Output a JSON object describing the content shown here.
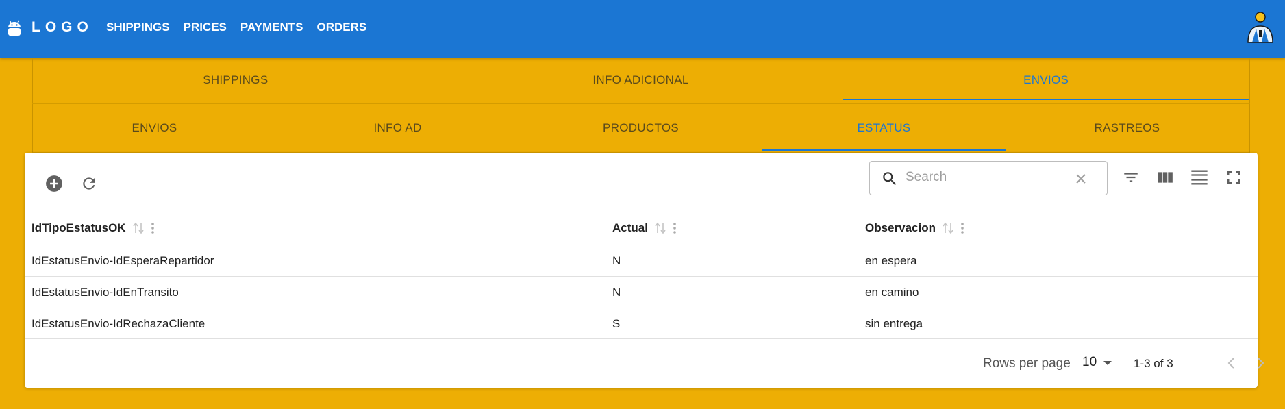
{
  "appbar": {
    "logo_text": "LOGO",
    "logo_icon": "android-icon",
    "nav": [
      "SHIPPINGS",
      "PRICES",
      "PAYMENTS",
      "ORDERS"
    ],
    "avatar_icon": "user-avatar-icon",
    "color": "#1B76D3"
  },
  "tabs_level1": [
    "SHIPPINGS",
    "INFO ADICIONAL",
    "ENVIOS"
  ],
  "tabs_level1_active": "ENVIOS",
  "tabs_level2": [
    "ENVIOS",
    "INFO AD",
    "PRODUCTOS",
    "ESTATUS",
    "RASTREOS"
  ],
  "tabs_level2_active": "ESTATUS",
  "toolbar": {
    "search_placeholder": "Search",
    "add_icon": "add-circle-icon",
    "refresh_icon": "refresh-icon",
    "filter_icon": "filter-icon",
    "columns_icon": "columns-icon",
    "density_icon": "density-icon",
    "fullscreen_icon": "fullscreen-icon"
  },
  "table": {
    "columns": [
      "IdTipoEstatusOK",
      "Actual",
      "Observacion"
    ],
    "rows": [
      [
        "IdEstatusEnvio-IdEsperaRepartidor",
        "N",
        "en espera"
      ],
      [
        "IdEstatusEnvio-IdEnTransito",
        "N",
        "en camino"
      ],
      [
        "IdEstatusEnvio-IdRechazaCliente",
        "S",
        "sin entrega"
      ]
    ]
  },
  "pagination": {
    "rows_per_page_label": "Rows per page",
    "rows_per_page": "10",
    "range": "1-3 of 3"
  },
  "colors": {
    "background": "#EDAE04",
    "accent": "#1B76D3"
  }
}
